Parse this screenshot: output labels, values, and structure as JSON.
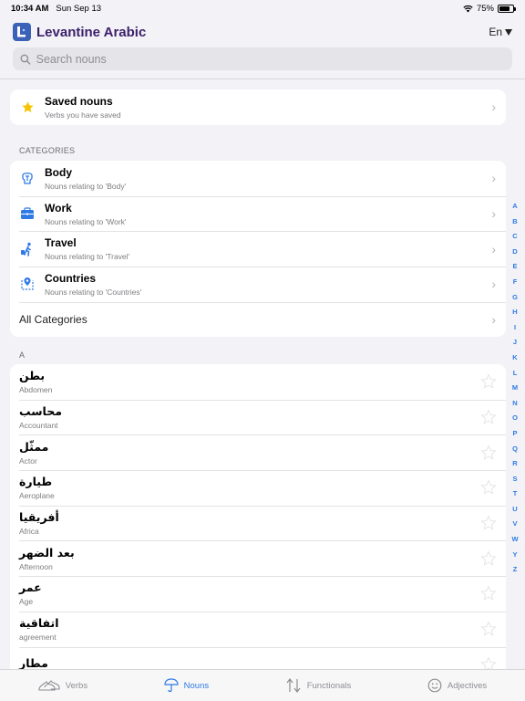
{
  "status": {
    "time": "10:34 AM",
    "date": "Sun Sep 13",
    "battery": "75%"
  },
  "header": {
    "title": "Levantine Arabic",
    "language": "En"
  },
  "search": {
    "placeholder": "Search nouns"
  },
  "saved": {
    "title": "Saved nouns",
    "subtitle": "Verbs you have saved"
  },
  "categories_label": "CATEGORIES",
  "categories": [
    {
      "title": "Body",
      "subtitle": "Nouns relating to 'Body'"
    },
    {
      "title": "Work",
      "subtitle": "Nouns relating to 'Work'"
    },
    {
      "title": "Travel",
      "subtitle": "Nouns relating to 'Travel'"
    },
    {
      "title": "Countries",
      "subtitle": "Nouns relating to 'Countries'"
    }
  ],
  "all_categories": "All Categories",
  "section_a": "A",
  "nouns": [
    {
      "arabic": "بطن",
      "english": "Abdomen"
    },
    {
      "arabic": "محاسب",
      "english": "Accountant"
    },
    {
      "arabic": "ممثّل",
      "english": "Actor"
    },
    {
      "arabic": "طيارة",
      "english": "Aeroplane"
    },
    {
      "arabic": "أفريقيا",
      "english": "Africa"
    },
    {
      "arabic": "بعد الضهر",
      "english": "Afternoon"
    },
    {
      "arabic": "عمر",
      "english": "Age"
    },
    {
      "arabic": "اتفاقية",
      "english": "agreement"
    },
    {
      "arabic": "مطار",
      "english": ""
    }
  ],
  "index_letters": [
    "A",
    "B",
    "C",
    "D",
    "E",
    "F",
    "G",
    "H",
    "I",
    "J",
    "K",
    "L",
    "M",
    "N",
    "O",
    "P",
    "Q",
    "R",
    "S",
    "T",
    "U",
    "V",
    "W",
    "Y",
    "Z"
  ],
  "tabs": [
    {
      "label": "Verbs",
      "icon": "shoes-icon"
    },
    {
      "label": "Nouns",
      "icon": "umbrella-icon"
    },
    {
      "label": "Functionals",
      "icon": "arrows-icon"
    },
    {
      "label": "Adjectives",
      "icon": "smiley-icon"
    }
  ],
  "colors": {
    "accent": "#2f7ae5",
    "title": "#3c1f69",
    "star": "#f5c400"
  }
}
